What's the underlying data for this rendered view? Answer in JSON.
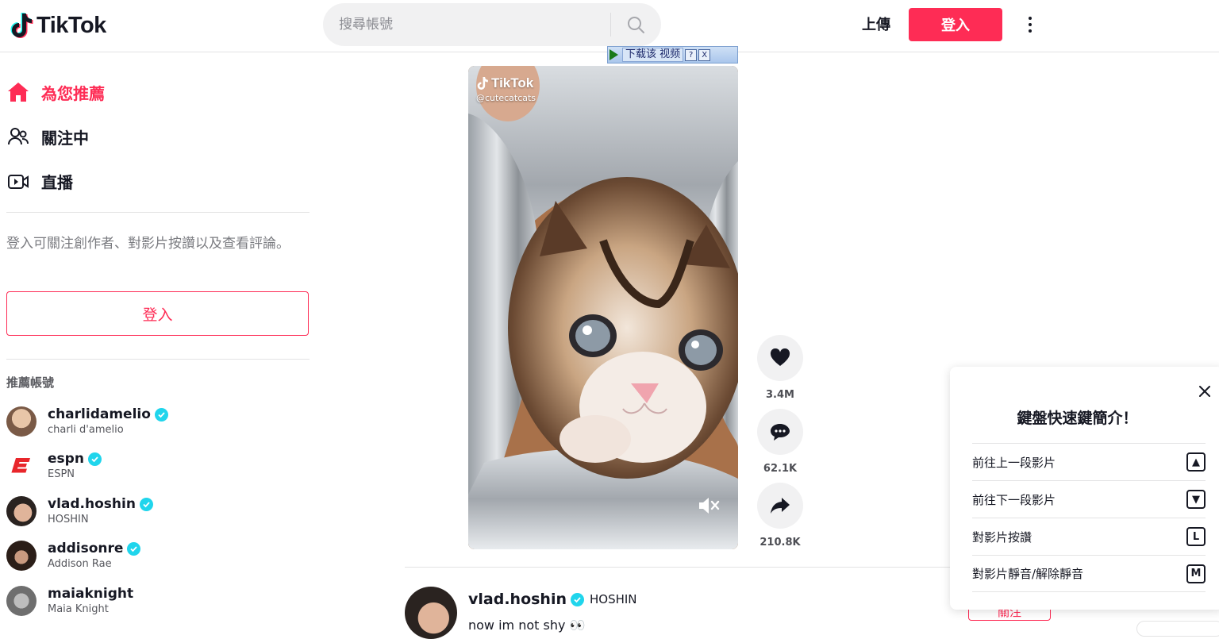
{
  "header": {
    "logo_text": "TikTok",
    "search_placeholder": "搜尋帳號",
    "upload_label": "上傳",
    "login_label": "登入"
  },
  "sidebar": {
    "nav": [
      {
        "label": "為您推薦",
        "icon": "home-icon",
        "active": true
      },
      {
        "label": "關注中",
        "icon": "users-icon",
        "active": false
      },
      {
        "label": "直播",
        "icon": "live-icon",
        "active": false
      }
    ],
    "login_hint": "登入可關注創作者、對影片按讚以及查看評論。",
    "login_button": "登入",
    "recommended_title": "推薦帳號",
    "accounts": [
      {
        "username": "charlidamelio",
        "nickname": "charli d'amelio",
        "verified": true
      },
      {
        "username": "espn",
        "nickname": "ESPN",
        "verified": true
      },
      {
        "username": "vlad.hoshin",
        "nickname": "HOSHIN",
        "verified": true
      },
      {
        "username": "addisonre",
        "nickname": "Addison Rae",
        "verified": true
      },
      {
        "username": "maiaknight",
        "nickname": "Maia Knight",
        "verified": false
      }
    ]
  },
  "ad_bar": {
    "label": "下载该 视频",
    "help": "?",
    "close": "X"
  },
  "video": {
    "watermark_brand": "TikTok",
    "watermark_handle": "@cutecatcats"
  },
  "actions": {
    "likes": "3.4M",
    "comments": "62.1K",
    "shares": "210.8K"
  },
  "next_post": {
    "username": "vlad.hoshin",
    "nickname": "HOSHIN",
    "description": "now im not shy 👀",
    "follow_label": "關注"
  },
  "shortcuts": {
    "title": "鍵盤快速鍵簡介！",
    "items": [
      {
        "label": "前往上一段影片",
        "key": "▲"
      },
      {
        "label": "前往下一段影片",
        "key": "▼"
      },
      {
        "label": "對影片按讚",
        "key": "L"
      },
      {
        "label": "對影片靜音/解除靜音",
        "key": "M"
      }
    ]
  },
  "colors": {
    "brand": "#fe2c55",
    "verified": "#20d5ec",
    "text": "#161823"
  }
}
